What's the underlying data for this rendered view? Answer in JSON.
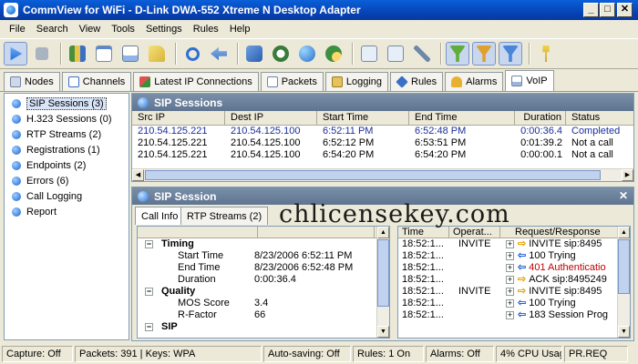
{
  "window": {
    "title": "CommView for WiFi - D-Link DWA-552 Xtreme N Desktop Adapter"
  },
  "menu": [
    "File",
    "Search",
    "View",
    "Tools",
    "Settings",
    "Rules",
    "Help"
  ],
  "toolbar": {
    "icons": [
      "start-capture-icon",
      "stop-capture-icon",
      "open-log-icon",
      "new-window-icon",
      "save-icon",
      "open-dropdown-icon",
      "search-icon",
      "back-icon",
      "network-icon",
      "scheduler-icon",
      "node-icon",
      "mac-alias-icon",
      "ip-alias-icon",
      "tools-icon",
      "filter-d-icon",
      "filter-m-icon",
      "filter-c-icon",
      "key-icon"
    ]
  },
  "tabs": [
    "Nodes",
    "Channels",
    "Latest IP Connections",
    "Packets",
    "Logging",
    "Rules",
    "Alarms",
    "VoIP"
  ],
  "sidebar": {
    "items": [
      "SIP Sessions (3)",
      "H.323 Sessions (0)",
      "RTP Streams (2)",
      "Registrations (1)",
      "Endpoints (2)",
      "Errors (6)",
      "Call Logging",
      "Report"
    ]
  },
  "sip_sessions": {
    "title": "SIP Sessions",
    "columns": [
      "Src IP",
      "Dest IP",
      "Start Time",
      "End Time",
      "Duration",
      "Status"
    ],
    "rows": [
      [
        "210.54.125.221",
        "210.54.125.100",
        "6:52:11 PM",
        "6:52:48 PM",
        "0:00:36.4",
        "Completed"
      ],
      [
        "210.54.125.221",
        "210.54.125.100",
        "6:52:12 PM",
        "6:53:51 PM",
        "0:01:39.2",
        "Not a call"
      ],
      [
        "210.54.125.221",
        "210.54.125.100",
        "6:54:20 PM",
        "6:54:20 PM",
        "0:00:00.1",
        "Not a call"
      ]
    ]
  },
  "sip_session": {
    "title": "SIP Session",
    "subtabs": [
      "Call Info",
      "RTP Streams (2)"
    ],
    "sections": {
      "timing": "Timing",
      "quality": "Quality",
      "sip": "SIP"
    },
    "timing_rows": [
      [
        "Start Time",
        "8/23/2006 6:52:11 PM"
      ],
      [
        "End Time",
        "8/23/2006 6:52:48 PM"
      ],
      [
        "Duration",
        "0:00:36.4"
      ]
    ],
    "quality_rows": [
      [
        "MOS Score",
        "3.4"
      ],
      [
        "R-Factor",
        "66"
      ]
    ],
    "flow_columns": [
      "Time",
      "Operat...",
      "Request/Response"
    ],
    "flow_rows": [
      {
        "time": "18:52:1...",
        "op": "INVITE",
        "dir": "right",
        "msg": "INVITE sip:8495",
        "color": "#000000"
      },
      {
        "time": "18:52:1...",
        "op": "",
        "dir": "left",
        "msg": "100 Trying",
        "color": "#000000"
      },
      {
        "time": "18:52:1...",
        "op": "",
        "dir": "left",
        "msg": "401 Authenticatio",
        "color": "#c00000"
      },
      {
        "time": "18:52:1...",
        "op": "",
        "dir": "right",
        "msg": "ACK sip:8495249",
        "color": "#000000"
      },
      {
        "time": "18:52:1...",
        "op": "INVITE",
        "dir": "right",
        "msg": "INVITE sip:8495",
        "color": "#000000"
      },
      {
        "time": "18:52:1...",
        "op": "",
        "dir": "left",
        "msg": "100 Trying",
        "color": "#000000"
      },
      {
        "time": "18:52:1...",
        "op": "",
        "dir": "left",
        "msg": "183 Session Prog",
        "color": "#000000"
      }
    ]
  },
  "watermark": "chlicensekey.com",
  "statusbar": [
    "Capture: Off",
    "Packets: 391 | Keys: WPA",
    "Auto-saving: Off",
    "Rules: 1 On",
    "Alarms: Off",
    "4% CPU Usag",
    "PR.REQ"
  ]
}
